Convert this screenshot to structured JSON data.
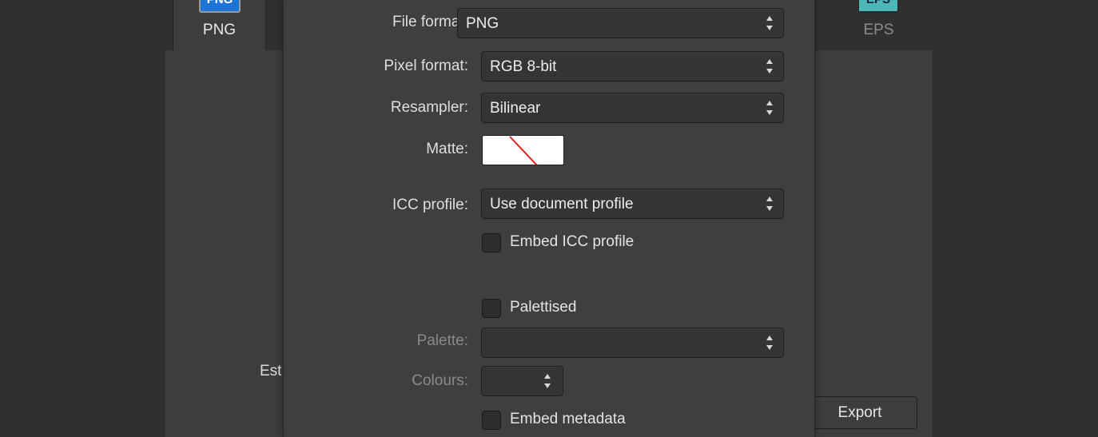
{
  "tabs": {
    "png": {
      "icon_text": "PNG",
      "label": "PNG"
    },
    "eps": {
      "icon_text": "EPS",
      "label": "EPS"
    }
  },
  "background": {
    "estimate_text": "Est",
    "export_label": "Export"
  },
  "settings": {
    "file_format": {
      "label": "File format:",
      "value": "PNG"
    },
    "pixel_format": {
      "label": "Pixel format:",
      "value": "RGB 8-bit"
    },
    "resampler": {
      "label": "Resampler:",
      "value": "Bilinear"
    },
    "matte": {
      "label": "Matte:"
    },
    "icc_profile": {
      "label": "ICC profile:",
      "value": "Use document profile"
    },
    "embed_icc": {
      "label": "Embed ICC profile",
      "checked": false
    },
    "palettised": {
      "label": "Palettised",
      "checked": false
    },
    "palette": {
      "label": "Palette:",
      "value": ""
    },
    "colours": {
      "label": "Colours:",
      "value": ""
    },
    "embed_metadata": {
      "label": "Embed metadata",
      "checked": false
    }
  },
  "colors": {
    "window_bg": "#3d3d3d",
    "panel_bg": "#3f3f3f",
    "png_icon": "#1d74d6",
    "eps_icon": "#4fb6b8",
    "matte_strike": "#e0201d"
  },
  "icons": {
    "stepper": "up-down-arrows-icon",
    "matte": "no-color-swatch-icon"
  }
}
